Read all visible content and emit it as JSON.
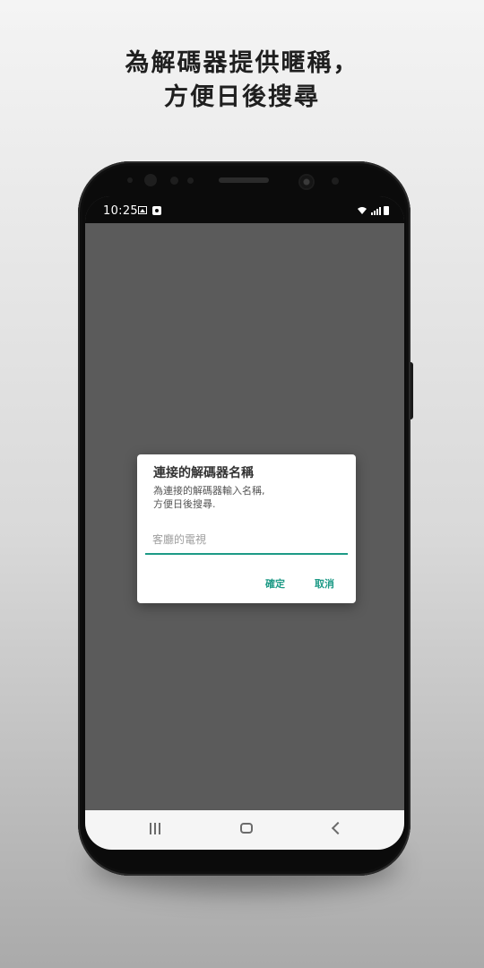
{
  "headline": {
    "line1": "為解碼器提供暱稱，",
    "line2": "方便日後搜尋"
  },
  "statusbar": {
    "time": "10:25",
    "icons": [
      "gallery-icon",
      "screen-record-icon",
      "wifi-icon",
      "signal-icon",
      "battery-icon"
    ]
  },
  "dialog": {
    "title": "連接的解碼器名稱",
    "message": "為連接的解碼器輸入名稱,\n方便日後搜尋.",
    "input_value": "",
    "input_placeholder": "客廳的電視",
    "ok_label": "確定",
    "cancel_label": "取消"
  },
  "navbar": {
    "icons": [
      "recent-apps-icon",
      "home-icon",
      "back-icon"
    ]
  },
  "colors": {
    "accent": "#1d9a86",
    "dim_overlay": "#5b5b5b",
    "phone_body": "#0b0b0b"
  }
}
